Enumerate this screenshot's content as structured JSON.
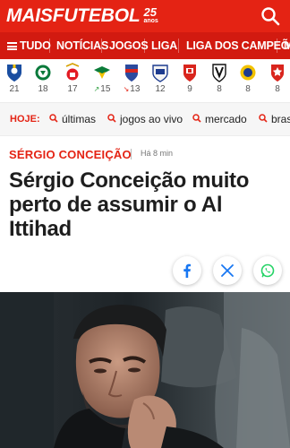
{
  "brand": {
    "name": "MAISFUTEBOL",
    "anniversary_number": "25",
    "anniversary_word": "anos"
  },
  "colors": {
    "brand_red": "#e42314",
    "nav_red": "#d21a10",
    "facebook": "#1877f2",
    "whatsapp": "#25d366"
  },
  "header": {
    "search_icon": "search-icon"
  },
  "nav": {
    "menu_label": "TUDO",
    "items": [
      "NOTÍCIAS",
      "JOGOS",
      "LIGA",
      "LIGA DOS CAMPEÕES",
      "M"
    ]
  },
  "clubs": [
    {
      "icon": "club-crest-icon",
      "value": "21"
    },
    {
      "icon": "club-crest-icon",
      "value": "18"
    },
    {
      "icon": "club-crest-icon",
      "value": "17"
    },
    {
      "icon": "club-crest-icon",
      "value": "15",
      "trend": "up"
    },
    {
      "icon": "club-crest-icon",
      "value": "13",
      "trend": "down"
    },
    {
      "icon": "club-crest-icon",
      "value": "12"
    },
    {
      "icon": "club-crest-icon",
      "value": "9"
    },
    {
      "icon": "club-crest-icon",
      "value": "8"
    },
    {
      "icon": "club-crest-icon",
      "value": "8"
    },
    {
      "icon": "club-crest-icon",
      "value": "8"
    }
  ],
  "today": {
    "label": "HOJE:",
    "items": [
      "últimas",
      "jogos ao vivo",
      "mercado",
      "bras"
    ]
  },
  "article": {
    "category": "SÉRGIO CONCEIÇÃO",
    "time": "Há 8 min",
    "headline": "Sérgio Conceição muito perto de assumir o Al Ittihad",
    "photo_subject": "man-in-black-cap-photo"
  },
  "share": {
    "facebook": "facebook-icon",
    "x": "x-icon",
    "whatsapp": "whatsapp-icon"
  }
}
